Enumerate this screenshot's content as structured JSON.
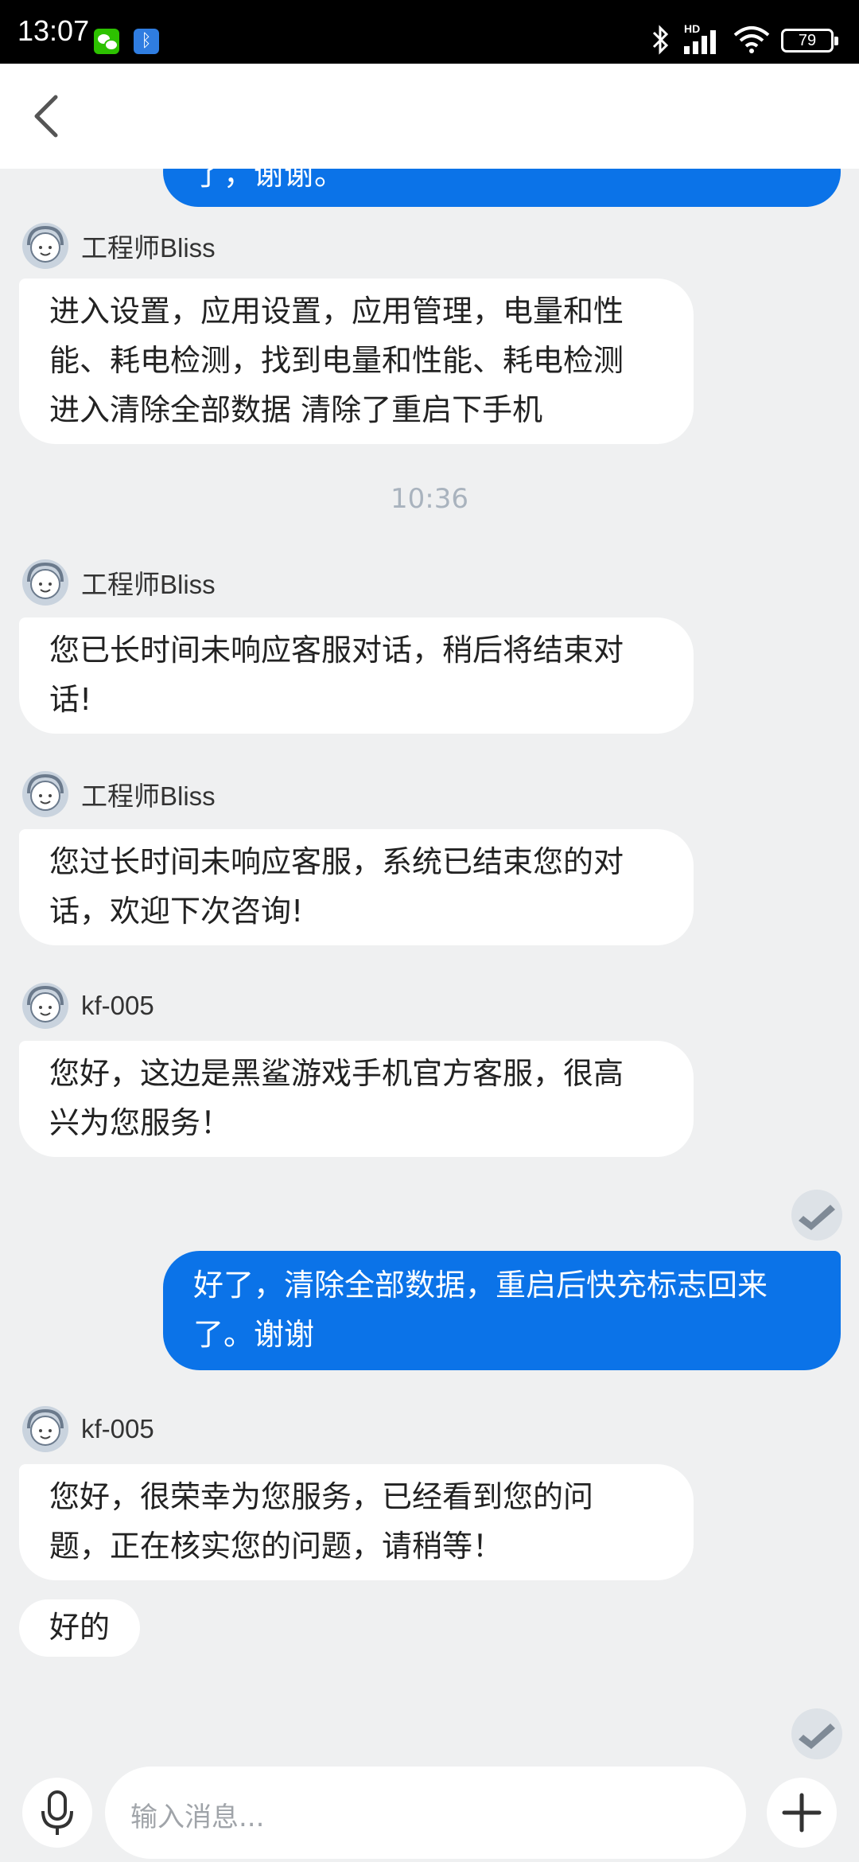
{
  "status_bar": {
    "time": "13:07",
    "network": "HD",
    "battery": "79"
  },
  "messages": [
    {
      "type": "agent",
      "sender": "工程师Bliss",
      "lines": [
        "进入设置，应用设置，应用管理，电量和性",
        "能、耗电检测，找到电量和性能、耗电检测",
        "进入清除全部数据 清除了重启下手机"
      ]
    },
    {
      "type": "time",
      "text": "10:36"
    },
    {
      "type": "agent",
      "sender": "工程师Bliss",
      "lines": [
        "您已长时间未响应客服对话，稍后将结束对",
        "话!"
      ]
    },
    {
      "type": "agent",
      "sender": "工程师Bliss",
      "lines": [
        "您过长时间未响应客服，系统已结束您的对",
        "话，欢迎下次咨询!"
      ]
    },
    {
      "type": "agent",
      "sender": "kf-005",
      "lines": [
        "您好，这边是黑鲨游戏手机官方客服，很高",
        "兴为您服务！"
      ]
    },
    {
      "type": "user",
      "lines": [
        "好了，清除全部数据，重启后快充标志回来",
        "了。谢谢"
      ]
    },
    {
      "type": "agent",
      "sender": "kf-005",
      "lines": [
        "您好，很荣幸为您服务，已经看到您的问",
        "题，正在核实您的问题，请稍等！"
      ]
    },
    {
      "type": "agent_followup",
      "lines": [
        "好的"
      ]
    }
  ],
  "partial_top_message": "了，谢谢。",
  "input": {
    "placeholder": "输入消息..."
  }
}
